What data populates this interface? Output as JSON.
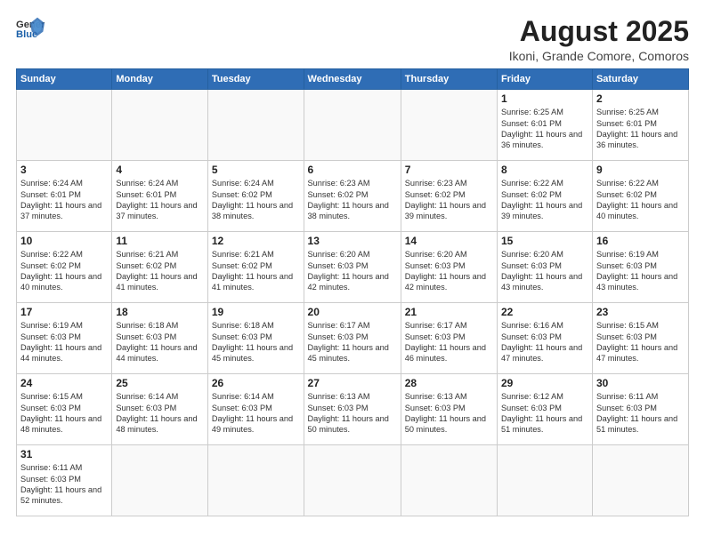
{
  "header": {
    "logo_general": "General",
    "logo_blue": "Blue",
    "title": "August 2025",
    "subtitle": "Ikoni, Grande Comore, Comoros"
  },
  "weekdays": [
    "Sunday",
    "Monday",
    "Tuesday",
    "Wednesday",
    "Thursday",
    "Friday",
    "Saturday"
  ],
  "rows": [
    [
      {
        "day": "",
        "info": ""
      },
      {
        "day": "",
        "info": ""
      },
      {
        "day": "",
        "info": ""
      },
      {
        "day": "",
        "info": ""
      },
      {
        "day": "",
        "info": ""
      },
      {
        "day": "1",
        "info": "Sunrise: 6:25 AM\nSunset: 6:01 PM\nDaylight: 11 hours and 36 minutes."
      },
      {
        "day": "2",
        "info": "Sunrise: 6:25 AM\nSunset: 6:01 PM\nDaylight: 11 hours and 36 minutes."
      }
    ],
    [
      {
        "day": "3",
        "info": "Sunrise: 6:24 AM\nSunset: 6:01 PM\nDaylight: 11 hours and 37 minutes."
      },
      {
        "day": "4",
        "info": "Sunrise: 6:24 AM\nSunset: 6:01 PM\nDaylight: 11 hours and 37 minutes."
      },
      {
        "day": "5",
        "info": "Sunrise: 6:24 AM\nSunset: 6:02 PM\nDaylight: 11 hours and 38 minutes."
      },
      {
        "day": "6",
        "info": "Sunrise: 6:23 AM\nSunset: 6:02 PM\nDaylight: 11 hours and 38 minutes."
      },
      {
        "day": "7",
        "info": "Sunrise: 6:23 AM\nSunset: 6:02 PM\nDaylight: 11 hours and 39 minutes."
      },
      {
        "day": "8",
        "info": "Sunrise: 6:22 AM\nSunset: 6:02 PM\nDaylight: 11 hours and 39 minutes."
      },
      {
        "day": "9",
        "info": "Sunrise: 6:22 AM\nSunset: 6:02 PM\nDaylight: 11 hours and 40 minutes."
      }
    ],
    [
      {
        "day": "10",
        "info": "Sunrise: 6:22 AM\nSunset: 6:02 PM\nDaylight: 11 hours and 40 minutes."
      },
      {
        "day": "11",
        "info": "Sunrise: 6:21 AM\nSunset: 6:02 PM\nDaylight: 11 hours and 41 minutes."
      },
      {
        "day": "12",
        "info": "Sunrise: 6:21 AM\nSunset: 6:02 PM\nDaylight: 11 hours and 41 minutes."
      },
      {
        "day": "13",
        "info": "Sunrise: 6:20 AM\nSunset: 6:03 PM\nDaylight: 11 hours and 42 minutes."
      },
      {
        "day": "14",
        "info": "Sunrise: 6:20 AM\nSunset: 6:03 PM\nDaylight: 11 hours and 42 minutes."
      },
      {
        "day": "15",
        "info": "Sunrise: 6:20 AM\nSunset: 6:03 PM\nDaylight: 11 hours and 43 minutes."
      },
      {
        "day": "16",
        "info": "Sunrise: 6:19 AM\nSunset: 6:03 PM\nDaylight: 11 hours and 43 minutes."
      }
    ],
    [
      {
        "day": "17",
        "info": "Sunrise: 6:19 AM\nSunset: 6:03 PM\nDaylight: 11 hours and 44 minutes."
      },
      {
        "day": "18",
        "info": "Sunrise: 6:18 AM\nSunset: 6:03 PM\nDaylight: 11 hours and 44 minutes."
      },
      {
        "day": "19",
        "info": "Sunrise: 6:18 AM\nSunset: 6:03 PM\nDaylight: 11 hours and 45 minutes."
      },
      {
        "day": "20",
        "info": "Sunrise: 6:17 AM\nSunset: 6:03 PM\nDaylight: 11 hours and 45 minutes."
      },
      {
        "day": "21",
        "info": "Sunrise: 6:17 AM\nSunset: 6:03 PM\nDaylight: 11 hours and 46 minutes."
      },
      {
        "day": "22",
        "info": "Sunrise: 6:16 AM\nSunset: 6:03 PM\nDaylight: 11 hours and 47 minutes."
      },
      {
        "day": "23",
        "info": "Sunrise: 6:15 AM\nSunset: 6:03 PM\nDaylight: 11 hours and 47 minutes."
      }
    ],
    [
      {
        "day": "24",
        "info": "Sunrise: 6:15 AM\nSunset: 6:03 PM\nDaylight: 11 hours and 48 minutes."
      },
      {
        "day": "25",
        "info": "Sunrise: 6:14 AM\nSunset: 6:03 PM\nDaylight: 11 hours and 48 minutes."
      },
      {
        "day": "26",
        "info": "Sunrise: 6:14 AM\nSunset: 6:03 PM\nDaylight: 11 hours and 49 minutes."
      },
      {
        "day": "27",
        "info": "Sunrise: 6:13 AM\nSunset: 6:03 PM\nDaylight: 11 hours and 50 minutes."
      },
      {
        "day": "28",
        "info": "Sunrise: 6:13 AM\nSunset: 6:03 PM\nDaylight: 11 hours and 50 minutes."
      },
      {
        "day": "29",
        "info": "Sunrise: 6:12 AM\nSunset: 6:03 PM\nDaylight: 11 hours and 51 minutes."
      },
      {
        "day": "30",
        "info": "Sunrise: 6:11 AM\nSunset: 6:03 PM\nDaylight: 11 hours and 51 minutes."
      }
    ],
    [
      {
        "day": "31",
        "info": "Sunrise: 6:11 AM\nSunset: 6:03 PM\nDaylight: 11 hours and 52 minutes."
      },
      {
        "day": "",
        "info": ""
      },
      {
        "day": "",
        "info": ""
      },
      {
        "day": "",
        "info": ""
      },
      {
        "day": "",
        "info": ""
      },
      {
        "day": "",
        "info": ""
      },
      {
        "day": "",
        "info": ""
      }
    ]
  ]
}
